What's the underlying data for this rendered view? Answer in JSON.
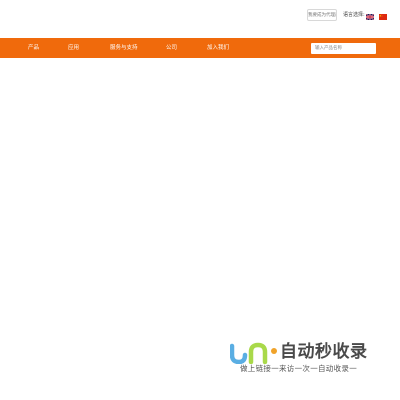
{
  "topbar": {
    "dealer_button": "我要成为代理商",
    "language_label": "语言选择:",
    "languages": [
      {
        "name": "English",
        "icon": "uk-flag-icon"
      },
      {
        "name": "中文",
        "icon": "china-flag-icon"
      }
    ]
  },
  "nav": {
    "background_color": "#f06a0c",
    "items": [
      {
        "label": "产品"
      },
      {
        "label": "应用"
      },
      {
        "label": "服务与支持"
      },
      {
        "label": "公司"
      },
      {
        "label": "加入我们"
      }
    ]
  },
  "search": {
    "placeholder": "输入产品名称",
    "value": ""
  },
  "watermark": {
    "title": "自动秒收录",
    "subtitle": "做上链接一来访一次一自动收录一"
  }
}
